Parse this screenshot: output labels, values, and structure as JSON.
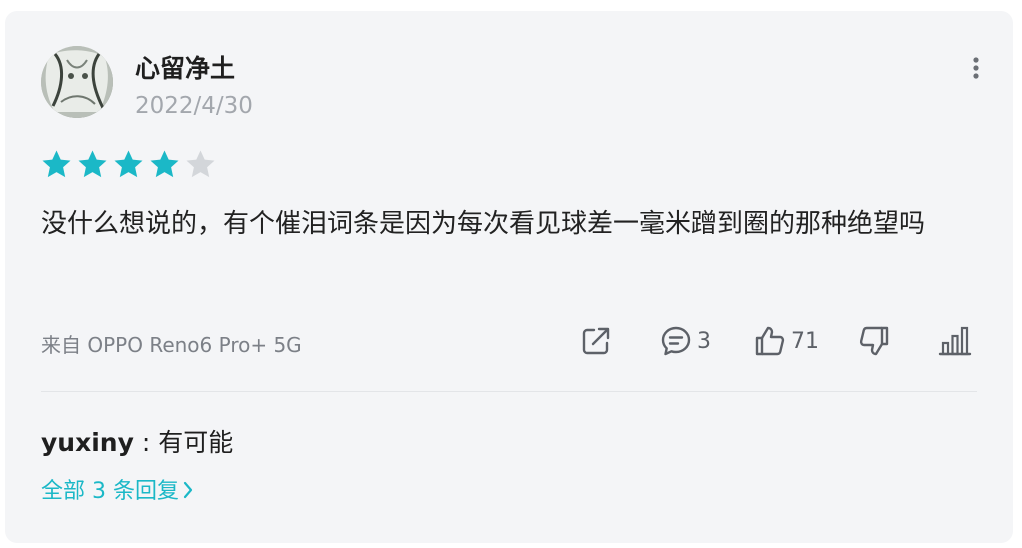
{
  "post": {
    "username": "心留净土",
    "date": "2022/4/30",
    "rating": 4,
    "max_rating": 5,
    "content": "没什么想说的，有个催泪词条是因为每次看见球差一毫米蹭到圈的那种绝望吗",
    "device": "来自 OPPO Reno6 Pro+ 5G"
  },
  "actions": {
    "comment_count": "3",
    "like_count": "71"
  },
  "reply": {
    "user": "yuxiny",
    "separator": " : ",
    "text": "有可能"
  },
  "all_replies": {
    "label": "全部 3 条回复"
  },
  "icons": {
    "more": "more-vertical-icon",
    "share": "share-icon",
    "comment": "comment-icon",
    "like": "thumbs-up-icon",
    "dislike": "thumbs-down-icon",
    "stats": "bar-chart-icon",
    "chevron": "chevron-right-icon"
  },
  "colors": {
    "accent": "#1bb8c7",
    "star_filled": "#1bb8c7",
    "star_empty": "#d3d6da",
    "card_background": "#f4f5f7",
    "muted_text": "#a3a7ad",
    "icon": "#5d6168"
  }
}
